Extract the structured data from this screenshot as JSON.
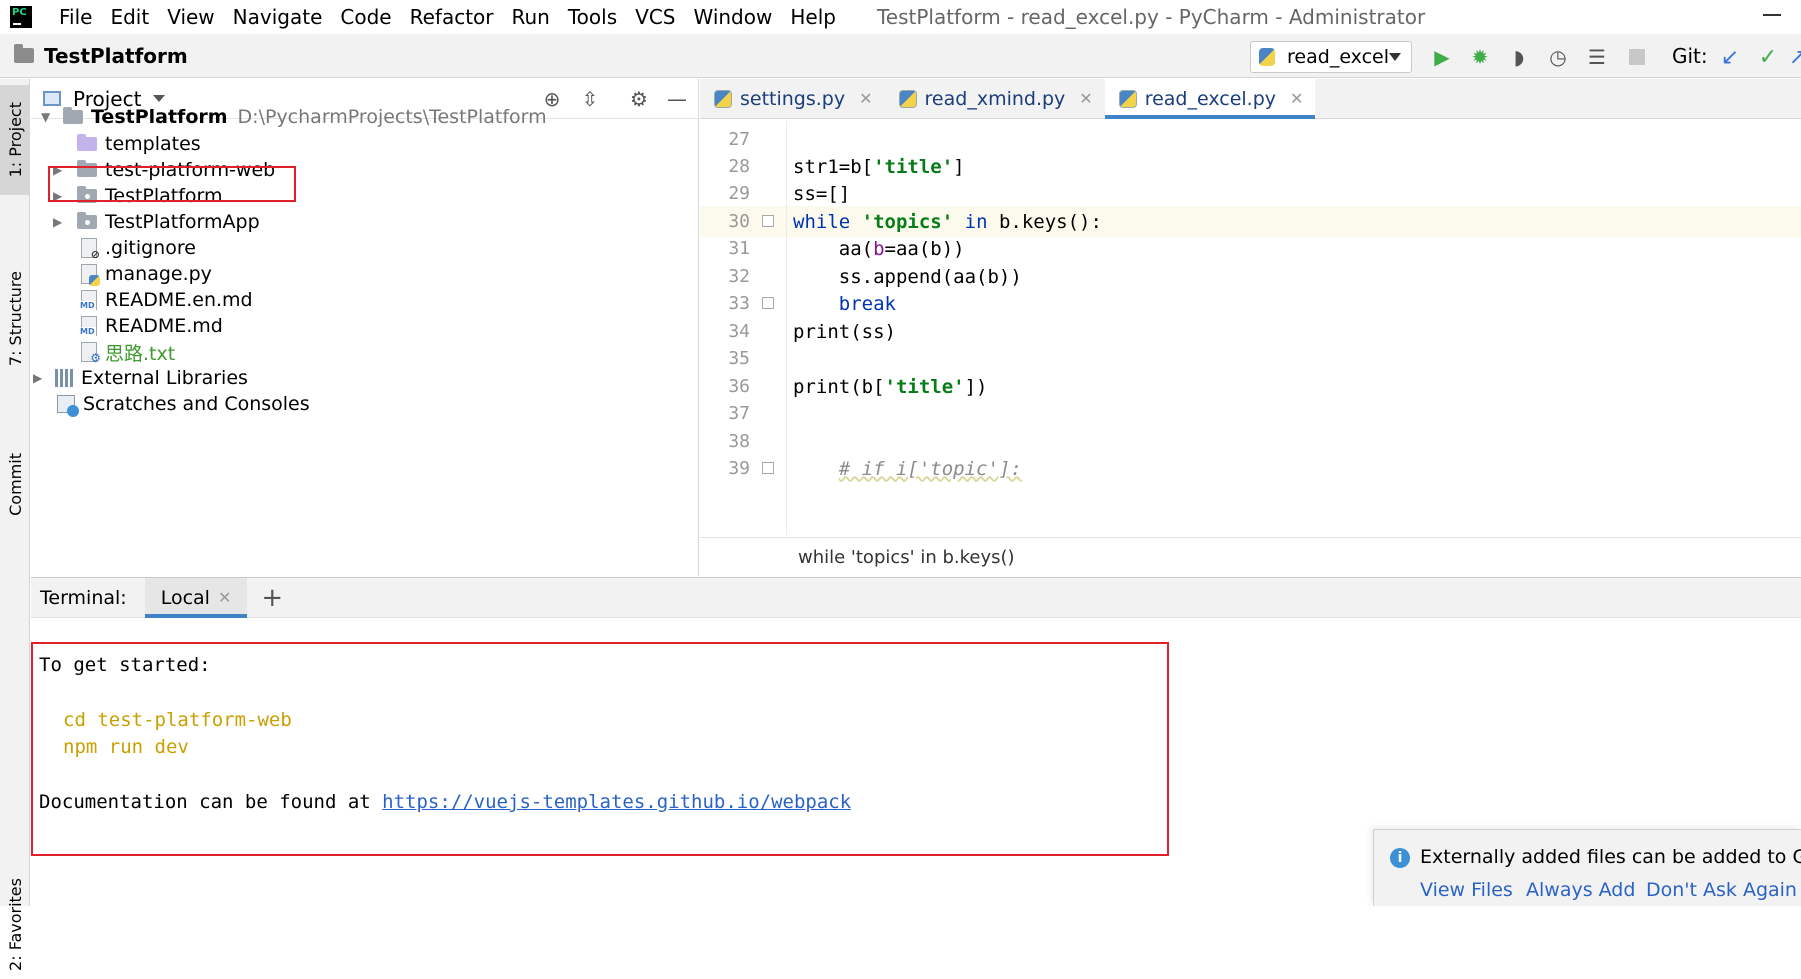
{
  "menu": [
    "File",
    "Edit",
    "View",
    "Navigate",
    "Code",
    "Refactor",
    "Run",
    "Tools",
    "VCS",
    "Window",
    "Help"
  ],
  "window_title": "TestPlatform - read_excel.py - PyCharm - Administrator",
  "navbar": {
    "project": "TestPlatform",
    "run_config": "read_excel",
    "git_label": "Git:"
  },
  "left_strip": {
    "project": "1: Project",
    "structure": "7: Structure",
    "commit": "Commit",
    "favorites": "2: Favorites"
  },
  "project_panel": {
    "title": "Project",
    "root": {
      "name": "TestPlatform",
      "path": "D:\\PycharmProjects\\TestPlatform"
    },
    "items": [
      {
        "label": "templates"
      },
      {
        "label": "test-platform-web"
      },
      {
        "label": "TestPlatform"
      },
      {
        "label": "TestPlatformApp"
      },
      {
        "label": ".gitignore"
      },
      {
        "label": "manage.py"
      },
      {
        "label": "README.en.md"
      },
      {
        "label": "README.md"
      },
      {
        "label": "思路.txt"
      },
      {
        "label": "External Libraries"
      },
      {
        "label": "Scratches and Consoles"
      }
    ]
  },
  "editor": {
    "tabs": [
      {
        "label": "settings.py"
      },
      {
        "label": "read_xmind.py"
      },
      {
        "label": "read_excel.py"
      }
    ],
    "line_numbers": [
      "27",
      "28",
      "29",
      "30",
      "31",
      "32",
      "33",
      "34",
      "35",
      "36",
      "37",
      "38",
      "39"
    ],
    "code": {
      "l28a": "str1=b[",
      "l28s": "'title'",
      "l28b": "]",
      "l29": "ss=[]",
      "l30k": "while",
      "l30s": "'topics'",
      "l30k2": "in",
      "l30b": "b.keys():",
      "l31a": "aa(",
      "l31p": "b",
      "l31b": "=aa(b))",
      "l32": "ss.append(aa(b))",
      "l33": "break",
      "l34": "print(ss)",
      "l36a": "print(b[",
      "l36s": "'title'",
      "l36b": "])",
      "l39": "# if i['topic']:"
    },
    "breadcrumb": "while 'topics' in b.keys()"
  },
  "terminal": {
    "label": "Terminal:",
    "tab": "Local",
    "lines": {
      "l1": "To get started:",
      "l2": "cd test-platform-web",
      "l3": "npm run dev",
      "l4": "Documentation can be found at ",
      "link": "https://vuejs-templates.github.io/webpack"
    }
  },
  "notification": {
    "text": "Externally added files can be added to Git",
    "view_files": "View Files",
    "always_add": "Always Add",
    "dont_ask": "Don't Ask Again"
  }
}
